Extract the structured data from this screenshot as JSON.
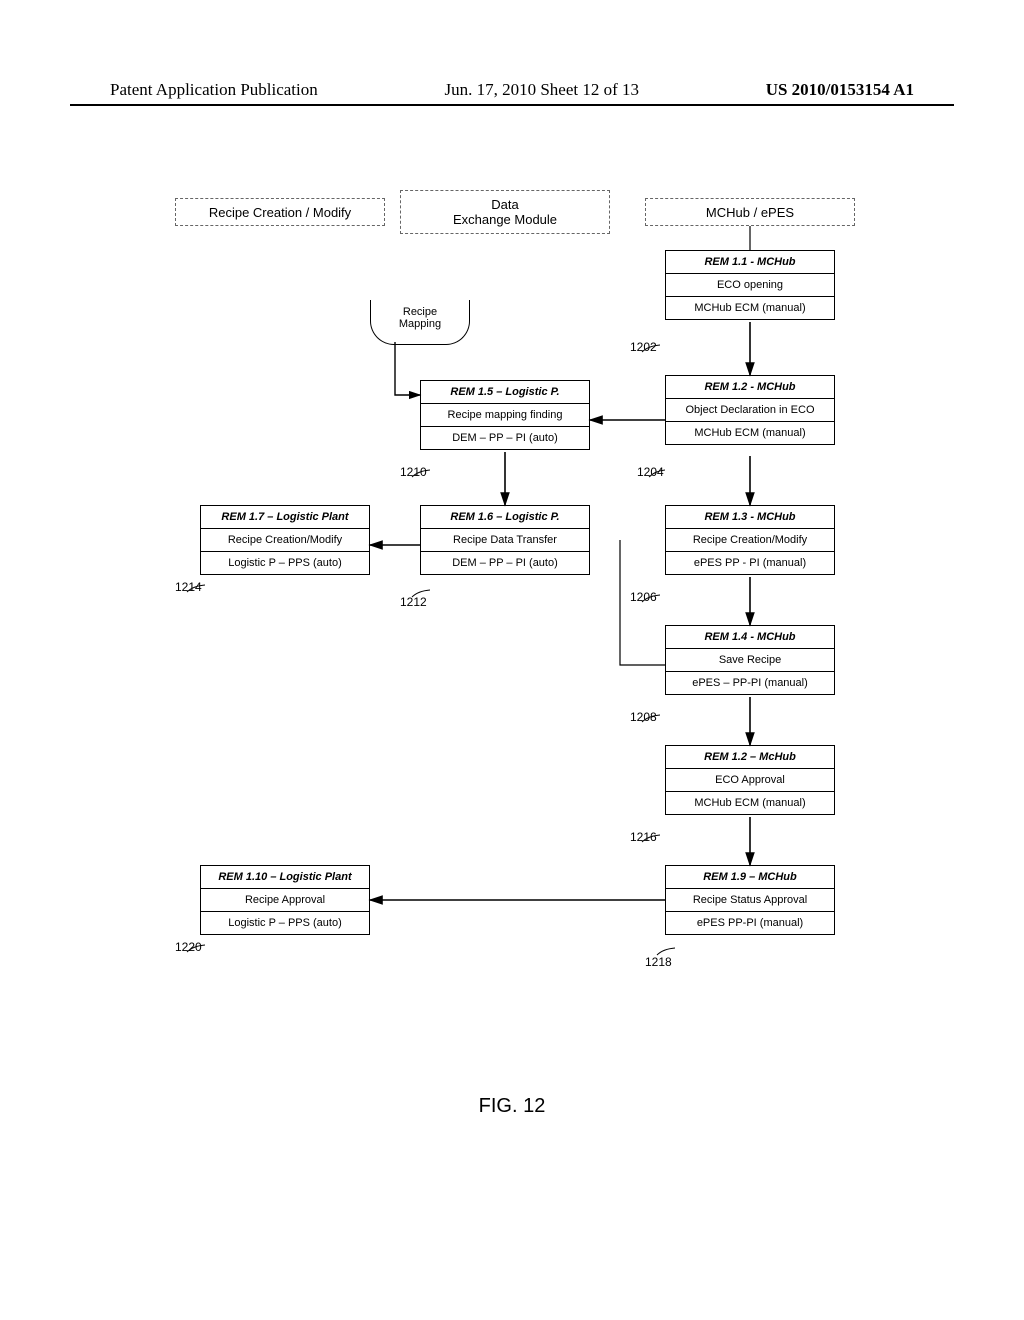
{
  "header": {
    "left": "Patent Application Publication",
    "center": "Jun. 17, 2010  Sheet 12 of 13",
    "right": "US 2010/0153154 A1"
  },
  "lanes": {
    "left": "Recipe Creation / Modify",
    "center_line1": "Data",
    "center_line2": "Exchange Module",
    "right": "MCHub / ePES"
  },
  "recipe_mapping_label": "Recipe\nMapping",
  "boxes": {
    "b1202": {
      "title": "REM 1.1 - MCHub",
      "mid": "ECO opening",
      "bot": "MCHub ECM (manual)",
      "ref": "1202"
    },
    "b1204": {
      "title": "REM 1.2 - MCHub",
      "mid": "Object Declaration in ECO",
      "bot": "MCHub ECM (manual)",
      "ref": "1204"
    },
    "b1206": {
      "title": "REM 1.3 - MCHub",
      "mid": "Recipe Creation/Modify",
      "bot": "ePES PP - PI (manual)",
      "ref": "1206"
    },
    "b1208": {
      "title": "REM 1.4 - MCHub",
      "mid": "Save Recipe",
      "bot": "ePES – PP-PI (manual)",
      "ref": "1208"
    },
    "b1216": {
      "title": "REM 1.2 – McHub",
      "mid": "ECO Approval",
      "bot": "MCHub ECM (manual)",
      "ref": "1216"
    },
    "b1218": {
      "title": "REM 1.9 – MCHub",
      "mid": "Recipe Status Approval",
      "bot": "ePES PP-PI (manual)",
      "ref": "1218"
    },
    "b1210": {
      "title": "REM 1.5 – Logistic P.",
      "mid": "Recipe mapping finding",
      "bot": "DEM – PP – PI (auto)",
      "ref": "1210"
    },
    "b1212": {
      "title": "REM 1.6 – Logistic P.",
      "mid": "Recipe Data Transfer",
      "bot": "DEM – PP – PI (auto)",
      "ref": "1212"
    },
    "b1214": {
      "title": "REM 1.7 – Logistic Plant",
      "mid": "Recipe Creation/Modify",
      "bot": "Logistic P – PPS (auto)",
      "ref": "1214"
    },
    "b1220": {
      "title": "REM 1.10 – Logistic Plant",
      "mid": "Recipe Approval",
      "bot": "Logistic P – PPS (auto)",
      "ref": "1220"
    }
  },
  "figure_label": "FIG. 12"
}
